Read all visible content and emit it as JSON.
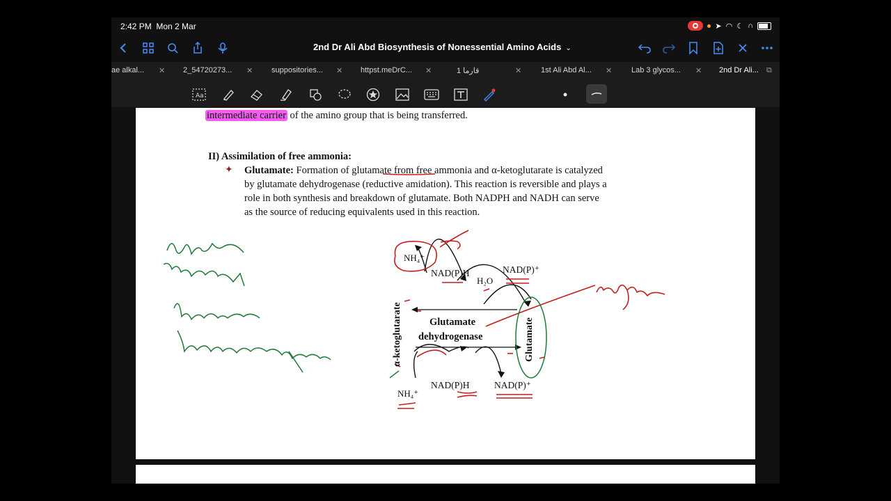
{
  "status": {
    "time": "2:42 PM",
    "date": "Mon 2 Mar"
  },
  "doc_title": "2nd Dr Ali Abd Biosynthesis of Nonessential Amino Acids",
  "tabs": [
    {
      "label": "ae alkal..."
    },
    {
      "label": "2_54720273..."
    },
    {
      "label": "suppositories..."
    },
    {
      "label": "httpst.meDrC..."
    },
    {
      "label": "قارما 1"
    },
    {
      "label": "1st Ali Abd Al..."
    },
    {
      "label": "Lab 3 glycos..."
    },
    {
      "label": "2nd Dr Ali..."
    }
  ],
  "icons": {
    "back": "chevron-left-icon",
    "grid": "grid-icon",
    "search": "search-icon",
    "share": "share-icon",
    "mic": "microphone-icon",
    "undo": "undo-icon",
    "redo": "redo-icon",
    "bookmark": "bookmark-icon",
    "add_page": "add-page-icon",
    "close": "close-icon",
    "more": "more-icon"
  },
  "colors": {
    "accent": "#4a8cf7",
    "highlight": "#f25cf0",
    "ink_red": "#c41e1e",
    "ink_green": "#1f7a3a"
  },
  "content": {
    "line_top_highlight": "intermediate carrier",
    "line_top_rest": " of the amino group that is being transferred.",
    "section_heading": "II) Assimilation of free ammonia:",
    "bullet_label": "Glutamate:",
    "para_line1": " Formation of glutamate from free ammonia and α-ketoglutarate is catalyzed",
    "para_line2": "by glutamate dehydrogenase (reductive amidation). This reaction is reversible and plays a",
    "para_line3": "role in both synthesis and breakdown of glutamate. Both NADPH and NADH can serve",
    "para_line4": "as the source of reducing equivalents used in this reaction."
  },
  "diagram": {
    "nh4_top": "NH₄⁺",
    "nadph_top": "NAD(P)H",
    "h2o": "H₂O",
    "nadp_top": "NAD(P)⁺",
    "left_label": "α-ketoglutarate",
    "enzyme_line1": "Glutamate",
    "enzyme_line2": "dehydrogenase",
    "right_label": "Glutamate",
    "nh4_bottom": "NH₄⁺",
    "nadph_bottom": "NAD(P)H",
    "nadp_bottom": "NAD(P)⁺"
  }
}
